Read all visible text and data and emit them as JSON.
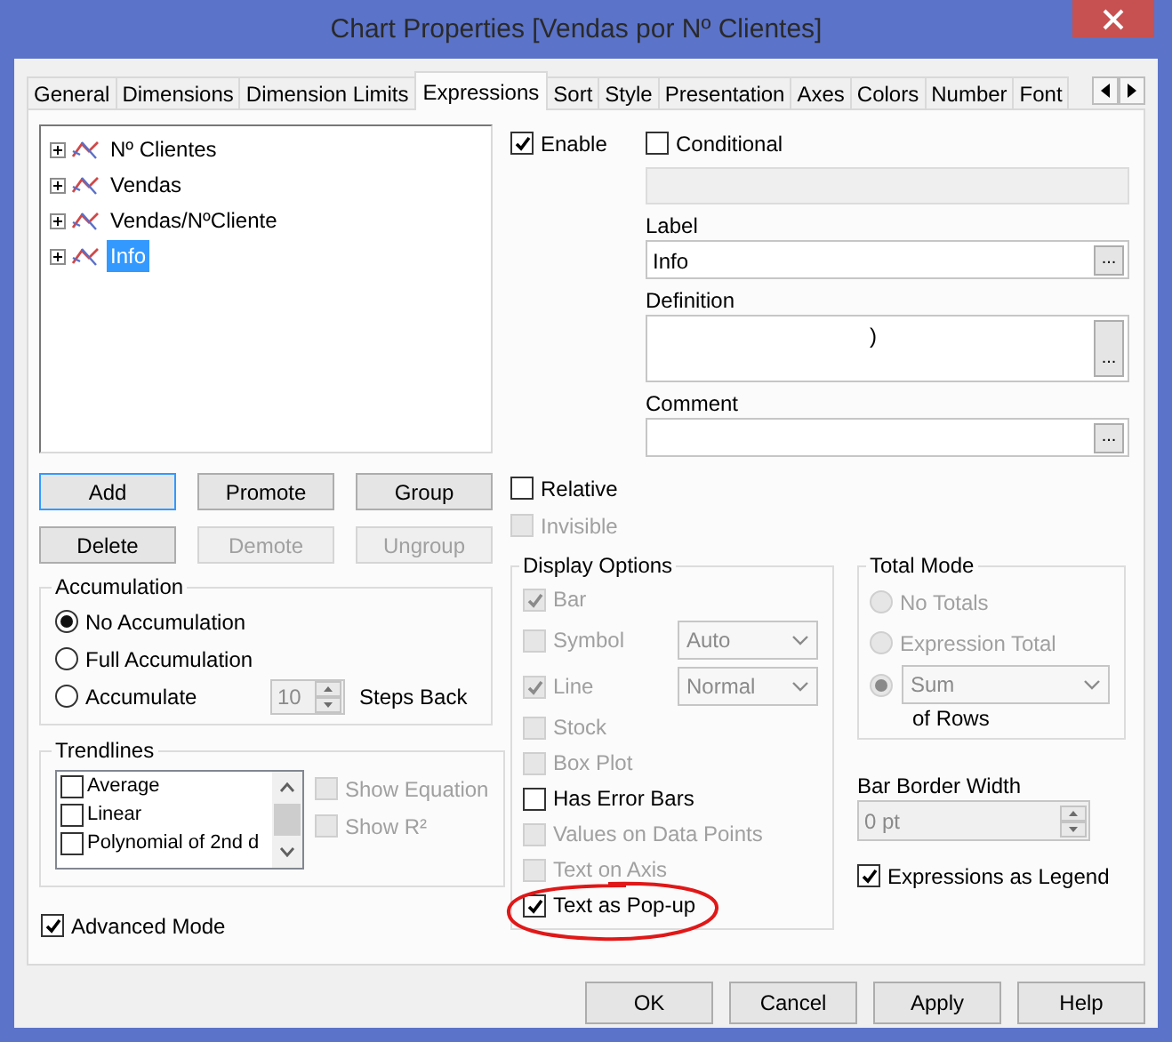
{
  "window": {
    "title": "Chart Properties [Vendas por Nº Clientes]"
  },
  "tabs": [
    {
      "label": "General",
      "selected": false
    },
    {
      "label": "Dimensions",
      "selected": false
    },
    {
      "label": "Dimension Limits",
      "selected": false
    },
    {
      "label": "Expressions",
      "selected": true
    },
    {
      "label": "Sort",
      "selected": false
    },
    {
      "label": "Style",
      "selected": false
    },
    {
      "label": "Presentation",
      "selected": false
    },
    {
      "label": "Axes",
      "selected": false
    },
    {
      "label": "Colors",
      "selected": false
    },
    {
      "label": "Number",
      "selected": false
    },
    {
      "label": "Font",
      "selected": false
    }
  ],
  "expressions": [
    {
      "label": "Nº Clientes",
      "selected": false,
      "expanded": false
    },
    {
      "label": "Vendas",
      "selected": false,
      "expanded": false
    },
    {
      "label": "Vendas/NºCliente",
      "selected": false,
      "expanded": false
    },
    {
      "label": "Info",
      "selected": true,
      "expanded": false
    }
  ],
  "expression_buttons": [
    {
      "label": "Add",
      "disabled": false,
      "focused": true
    },
    {
      "label": "Promote",
      "disabled": false,
      "focused": false
    },
    {
      "label": "Group",
      "disabled": false,
      "focused": false
    },
    {
      "label": "Delete",
      "disabled": false,
      "focused": false
    },
    {
      "label": "Demote",
      "disabled": true,
      "focused": false
    },
    {
      "label": "Ungroup",
      "disabled": true,
      "focused": false
    }
  ],
  "enable": {
    "label": "Enable",
    "checked": true
  },
  "conditional": {
    "label": "Conditional",
    "checked": false
  },
  "condition_field": {
    "disabled": true
  },
  "label_field": {
    "caption": "Label",
    "value": "Info",
    "button": "..."
  },
  "definition_field": {
    "caption": "Definition",
    "value": ")",
    "button": "..."
  },
  "comment_field": {
    "caption": "Comment",
    "button": "..."
  },
  "relative": {
    "label": "Relative",
    "checked": false,
    "disabled": false
  },
  "invisible": {
    "label": "Invisible",
    "checked": false,
    "disabled": true
  },
  "accumulation": {
    "title": "Accumulation",
    "options": [
      {
        "label": "No Accumulation",
        "selected": true
      },
      {
        "label": "Full Accumulation",
        "selected": false
      },
      {
        "label": "Accumulate",
        "selected": false
      }
    ],
    "steps": {
      "value": "10",
      "disabled": true
    },
    "steps_label": "Steps Back"
  },
  "trendlines": {
    "title": "Trendlines",
    "items": [
      {
        "label": "Average",
        "checked": false
      },
      {
        "label": "Linear",
        "checked": false
      },
      {
        "label": "Polynomial of 2nd d",
        "checked": false
      }
    ],
    "show_equation": {
      "label": "Show Equation",
      "checked": false,
      "disabled": true
    },
    "show_r2": {
      "label": "Show R²",
      "checked": false,
      "disabled": true
    }
  },
  "advanced_mode": {
    "label": "Advanced Mode",
    "checked": true
  },
  "display_options": {
    "title": "Display Options",
    "items": [
      {
        "label": "Bar",
        "checked": true,
        "disabled": true,
        "highlighted": false
      },
      {
        "label": "Symbol",
        "checked": false,
        "disabled": true,
        "dropdown": "Auto",
        "highlighted": false
      },
      {
        "label": "Line",
        "checked": true,
        "disabled": true,
        "dropdown": "Normal",
        "highlighted": false
      },
      {
        "label": "Stock",
        "checked": false,
        "disabled": true,
        "highlighted": false
      },
      {
        "label": "Box Plot",
        "checked": false,
        "disabled": true,
        "highlighted": false
      },
      {
        "label": "Has Error Bars",
        "checked": false,
        "disabled": false,
        "highlighted": false
      },
      {
        "label": "Values on Data Points",
        "checked": false,
        "disabled": true,
        "highlighted": false
      },
      {
        "label": "Text on Axis",
        "checked": false,
        "disabled": true,
        "highlighted": false
      },
      {
        "label": "Text as Pop-up",
        "checked": true,
        "disabled": false,
        "highlighted": true
      }
    ]
  },
  "total_mode": {
    "title": "Total Mode",
    "options": [
      {
        "kind": "label",
        "label": "No Totals",
        "selected": false,
        "disabled": true
      },
      {
        "kind": "label",
        "label": "Expression Total",
        "selected": false,
        "disabled": true
      },
      {
        "kind": "dropdown",
        "value": "Sum",
        "selected": true,
        "disabled": true
      }
    ],
    "suffix": "of Rows"
  },
  "bar_border_width": {
    "caption": "Bar Border Width",
    "value": "0 pt",
    "disabled": true
  },
  "expressions_as_legend": {
    "label": "Expressions as Legend",
    "checked": true
  },
  "buttons": [
    {
      "label": "OK"
    },
    {
      "label": "Cancel"
    },
    {
      "label": "Apply"
    },
    {
      "label": "Help"
    }
  ]
}
